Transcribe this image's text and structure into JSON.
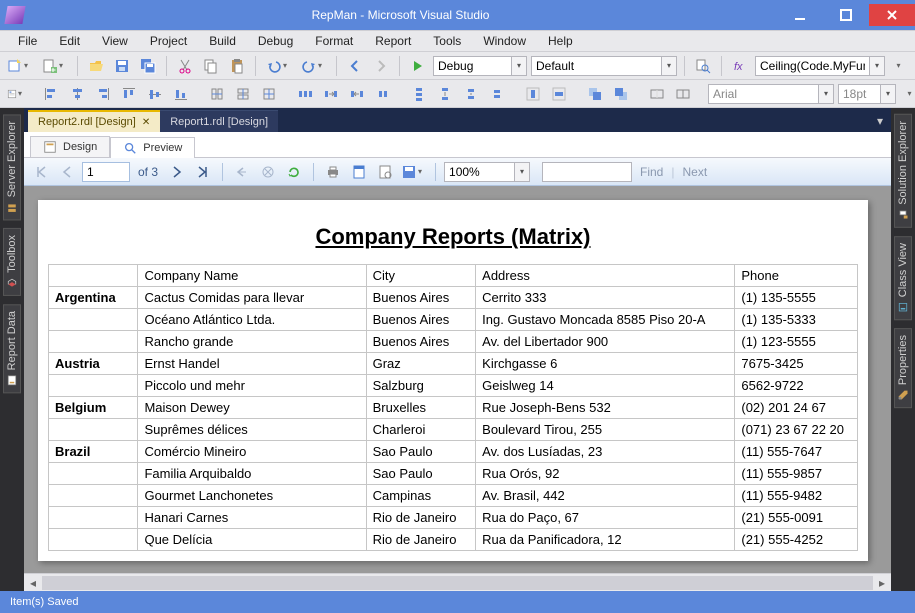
{
  "window": {
    "title": "RepMan - Microsoft Visual Studio"
  },
  "menu": [
    "File",
    "Edit",
    "View",
    "Project",
    "Build",
    "Debug",
    "Format",
    "Report",
    "Tools",
    "Window",
    "Help"
  ],
  "toolbar1": {
    "config_combo": "Debug",
    "platform_combo": "Default",
    "expr_box": "Ceiling(Code.MyFunc(Fields!Ch"
  },
  "toolbar2": {
    "font_combo": "Arial",
    "size_combo": "18pt"
  },
  "left_tabs": [
    "Server Explorer",
    "Toolbox",
    "Report Data"
  ],
  "right_tabs": [
    "Solution Explorer",
    "Class View",
    "Properties"
  ],
  "doc_tabs": [
    {
      "label": "Report2.rdl [Design]",
      "active": true
    },
    {
      "label": "Report1.rdl [Design]",
      "active": false
    }
  ],
  "sub_tabs": {
    "design": "Design",
    "preview": "Preview",
    "active": "preview"
  },
  "preview_bar": {
    "page": "1",
    "of_label": "of  3",
    "zoom": "100%",
    "find_label": "Find",
    "next_label": "Next"
  },
  "chart_data": {
    "type": "table",
    "title": "Company Reports (Matrix)",
    "columns": [
      "Company Name",
      "City",
      "Address",
      "Phone"
    ],
    "groups": [
      {
        "country": "Argentina",
        "rows": [
          [
            "Cactus Comidas para llevar",
            "Buenos Aires",
            "Cerrito 333",
            "(1) 135-5555"
          ],
          [
            "Océano Atlántico Ltda.",
            "Buenos Aires",
            "Ing. Gustavo Moncada 8585 Piso 20-A",
            "(1) 135-5333"
          ],
          [
            "Rancho grande",
            "Buenos Aires",
            "Av. del Libertador 900",
            "(1) 123-5555"
          ]
        ]
      },
      {
        "country": "Austria",
        "rows": [
          [
            "Ernst Handel",
            "Graz",
            "Kirchgasse 6",
            "7675-3425"
          ],
          [
            "Piccolo und mehr",
            "Salzburg",
            "Geislweg 14",
            "6562-9722"
          ]
        ]
      },
      {
        "country": "Belgium",
        "rows": [
          [
            "Maison Dewey",
            "Bruxelles",
            "Rue Joseph-Bens 532",
            "(02) 201 24 67"
          ],
          [
            "Suprêmes délices",
            "Charleroi",
            "Boulevard Tirou, 255",
            "(071) 23 67 22 20"
          ]
        ]
      },
      {
        "country": "Brazil",
        "rows": [
          [
            "Comércio Mineiro",
            "Sao Paulo",
            "Av. dos Lusíadas, 23",
            "(11) 555-7647"
          ],
          [
            "Familia Arquibaldo",
            "Sao Paulo",
            "Rua Orós, 92",
            "(11) 555-9857"
          ],
          [
            "Gourmet Lanchonetes",
            "Campinas",
            "Av. Brasil, 442",
            "(11) 555-9482"
          ],
          [
            "Hanari Carnes",
            "Rio de Janeiro",
            "Rua do Paço, 67",
            "(21) 555-0091"
          ],
          [
            "Que Delícia",
            "Rio de Janeiro",
            "Rua da Panificadora, 12",
            "(21) 555-4252"
          ]
        ]
      }
    ]
  },
  "status": "Item(s) Saved"
}
